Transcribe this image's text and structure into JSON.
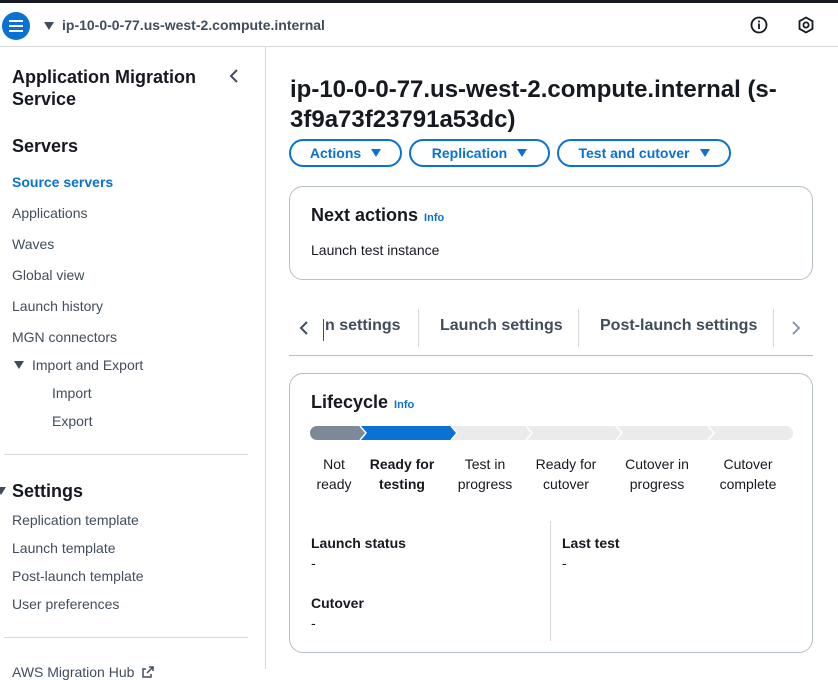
{
  "topbar": {
    "host": "ip-10-0-0-77.us-west-2.compute.internal"
  },
  "sidebar": {
    "title": "Application Migration Service",
    "sections": {
      "servers": "Servers",
      "settings": "Settings"
    },
    "items": {
      "source_servers": "Source servers",
      "applications": "Applications",
      "waves": "Waves",
      "global_view": "Global view",
      "launch_history": "Launch history",
      "mgn_connectors": "MGN connectors",
      "import_export": "Import and Export",
      "import": "Import",
      "export": "Export",
      "replication_template": "Replication template",
      "launch_template": "Launch template",
      "post_launch_template": "Post-launch template",
      "user_preferences": "User preferences",
      "aws_migration_hub": "AWS Migration Hub"
    }
  },
  "main": {
    "title": "ip-10-0-0-77.us-west-2.compute.internal (s-3f9a73f23791a53dc)",
    "buttons": {
      "actions": "Actions",
      "replication": "Replication",
      "test_cutover": "Test and cutover"
    },
    "next_actions": {
      "heading": "Next actions",
      "info": "Info",
      "text": "Launch test instance"
    },
    "tabs": {
      "partial": "n settings",
      "launch": "Launch settings",
      "post_launch": "Post-launch settings"
    },
    "lifecycle": {
      "heading": "Lifecycle",
      "info": "Info",
      "steps": [
        "Not ready",
        "Ready for testing",
        "Test in progress",
        "Ready for cutover",
        "Cutover in progress",
        "Cutover complete"
      ],
      "current_step": "Ready for testing",
      "launch_status_label": "Launch status",
      "launch_status_value": "-",
      "last_test_label": "Last test",
      "last_test_value": "-",
      "cutover_label": "Cutover",
      "cutover_value": "-"
    }
  },
  "colors": {
    "accent": "#0972d3",
    "completed_step": "#7d8998",
    "pending_step": "#e9ebed"
  }
}
